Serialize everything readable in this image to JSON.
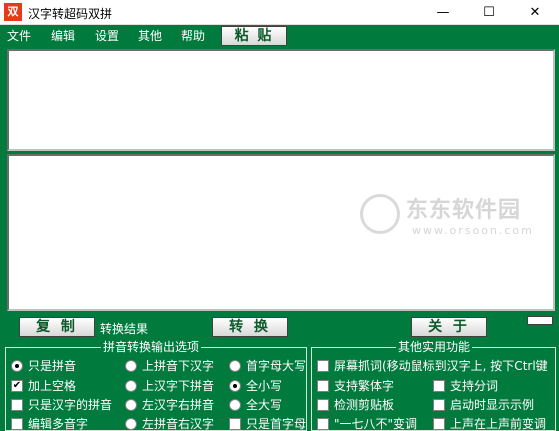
{
  "window": {
    "icon_text": "双",
    "title": "汉字转超码双拼",
    "minimize": "—",
    "maximize": "☐",
    "close": "✕"
  },
  "menu": {
    "items": [
      "文件",
      "编辑",
      "设置",
      "其他",
      "帮助"
    ],
    "paste_button": "粘 贴"
  },
  "watermark": {
    "text": "东东软件园",
    "url": "www.orsoon.com"
  },
  "actions": {
    "copy": "复 制",
    "result_label": "转换结果",
    "convert": "转 换",
    "about": "关 于"
  },
  "output_options": {
    "legend": "拼音转换输出选项",
    "col1": [
      {
        "label": "只是拼音",
        "type": "radio",
        "checked": true
      },
      {
        "label": "加上空格",
        "type": "checkbox",
        "checked": true
      },
      {
        "label": "只是汉字的拼音",
        "type": "checkbox",
        "checked": false
      },
      {
        "label": "编辑多音字",
        "type": "checkbox",
        "checked": false
      }
    ],
    "col2": [
      {
        "label": "上拼音下汉字",
        "type": "radio",
        "checked": false
      },
      {
        "label": "上汉字下拼音",
        "type": "radio",
        "checked": false
      },
      {
        "label": "左汉字右拼音",
        "type": "radio",
        "checked": false
      },
      {
        "label": "左拼音右汉字",
        "type": "radio",
        "checked": false
      }
    ],
    "col3": [
      {
        "label": "首字母大写",
        "type": "radio",
        "checked": false
      },
      {
        "label": "全小写",
        "type": "radio",
        "checked": true
      },
      {
        "label": "全大写",
        "type": "radio",
        "checked": false
      },
      {
        "label": "只是首字母",
        "type": "checkbox",
        "checked": false
      }
    ]
  },
  "utility": {
    "legend": "其他实用功能",
    "items": [
      {
        "label": "屏幕抓词(移动鼠标到汉字上, 按下Ctrl键",
        "checked": false
      },
      {
        "label": "支持繁体字",
        "checked": false
      },
      {
        "label": "支持分词",
        "checked": false
      },
      {
        "label": "检测剪贴板",
        "checked": false
      },
      {
        "label": "启动时显示示例",
        "checked": false
      },
      {
        "label": "\"一七八不\"变调",
        "checked": false
      },
      {
        "label": "上声在上声前变调",
        "checked": false
      }
    ]
  }
}
